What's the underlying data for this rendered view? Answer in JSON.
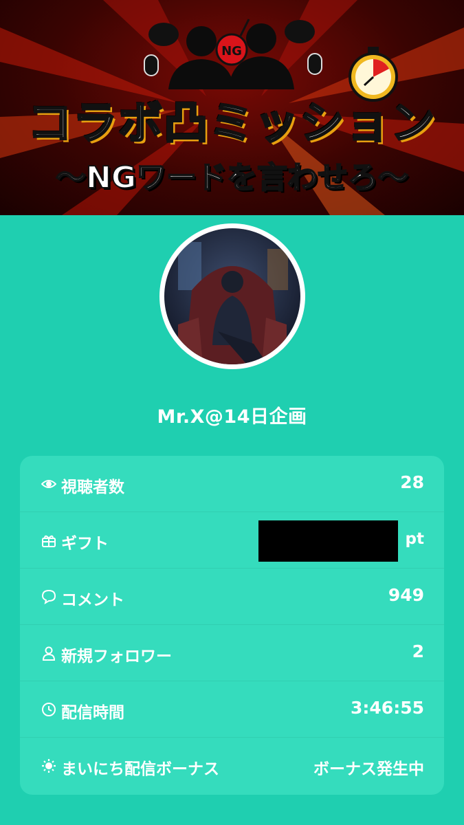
{
  "banner": {
    "title": "コラボ凸ミッション",
    "subtitle": "〜NGワードを言わせろ〜",
    "badge": "NG",
    "colors": {
      "background": "#3a0402",
      "accent": "#e8a010"
    }
  },
  "profile": {
    "avatar_icon": "avatar-image",
    "username": "Mr.X@14日企画"
  },
  "stats": {
    "viewers": {
      "icon": "eye-icon",
      "label": "視聴者数",
      "value": "28"
    },
    "gifts": {
      "icon": "gift-icon",
      "label": "ギフト",
      "value_redacted": true,
      "unit": "pt"
    },
    "comments": {
      "icon": "comment-icon",
      "label": "コメント",
      "value": "949"
    },
    "new_followers": {
      "icon": "person-icon",
      "label": "新規フォロワー",
      "value": "2"
    },
    "stream_time": {
      "icon": "clock-icon",
      "label": "配信時間",
      "value": "3:46:55"
    },
    "daily_bonus": {
      "icon": "sun-icon",
      "label": "まいにち配信ボーナス",
      "value": "ボーナス発生中"
    }
  },
  "colors": {
    "page_background": "#1fcfb0",
    "card_background": "#35dcbd",
    "text": "#ffffff"
  }
}
